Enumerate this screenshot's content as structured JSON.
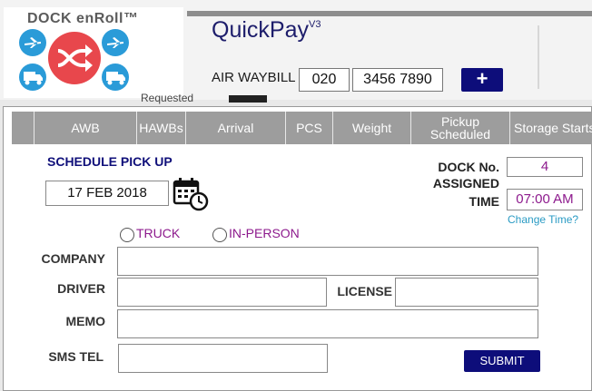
{
  "header": {
    "logo_text": "DOCK enRoll™",
    "app_title": "QuickPay",
    "app_version": "V3",
    "waybill_label": "AIR WAYBILL",
    "waybill_prefix": "020",
    "waybill_number": "3456 7890",
    "add_label": "+",
    "partial_text": "Requested"
  },
  "table": {
    "columns": [
      "AWB",
      "HAWBs",
      "Arrival",
      "PCS",
      "Weight",
      "Pickup Scheduled",
      "Storage Starts"
    ]
  },
  "form": {
    "schedule_label": "SCHEDULE PICK UP",
    "date": "17 FEB 2018",
    "dock_label": "DOCK No. ASSIGNED",
    "dock_value": "4",
    "time_label": "TIME",
    "time_value": "07:00 AM",
    "change_time": "Change Time?",
    "radio_truck": "TRUCK",
    "radio_in_person": "IN-PERSON",
    "company_label": "COMPANY",
    "driver_label": "DRIVER",
    "license_label": "LICENSE",
    "memo_label": "MEMO",
    "sms_label": "SMS TEL",
    "submit_label": "SUBMIT"
  },
  "colors": {
    "accent": "#0d0d7a",
    "value_text": "#8d1a8d",
    "logo_red": "#e8474c",
    "logo_blue": "#2a9bd8",
    "link": "#2a9bc4"
  },
  "icons": [
    "airplane-icon",
    "shuffle-icon",
    "truck-icon",
    "calendar-clock-icon"
  ]
}
